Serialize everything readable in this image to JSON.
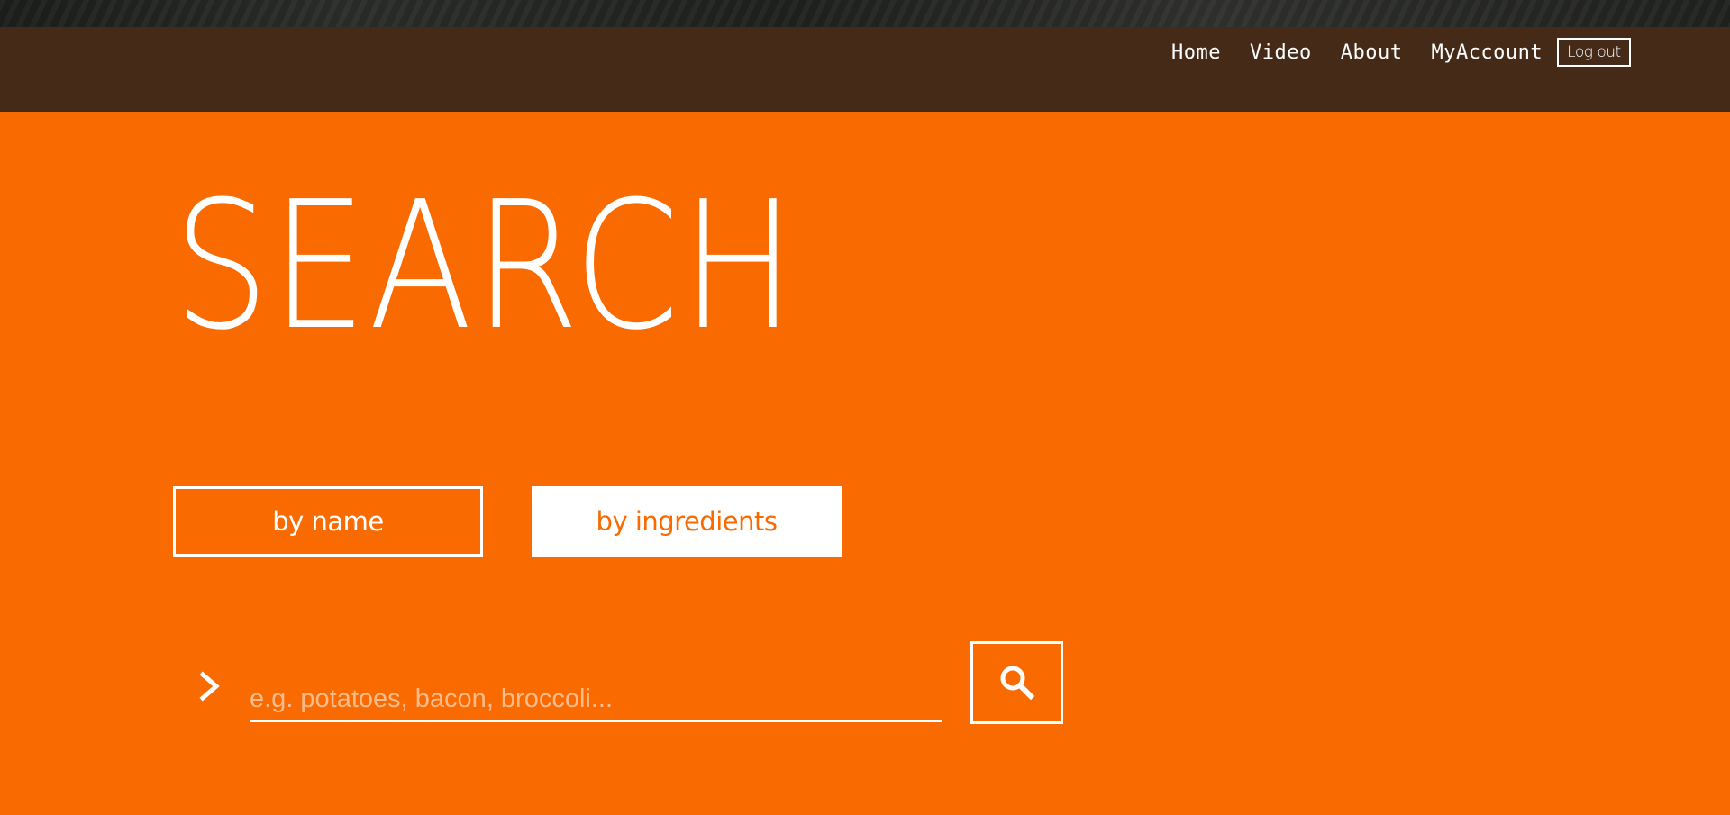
{
  "nav": {
    "links": [
      "Home",
      "Video",
      "About",
      "MyAccount"
    ],
    "logout_label": "Log out"
  },
  "main": {
    "title": "SEARCH",
    "modes": {
      "by_name_label": "by name",
      "by_ingredients_label": "by ingredients",
      "active": "by ingredients"
    },
    "search": {
      "value": "",
      "placeholder": "e.g. potatoes, bacon, broccoli...",
      "prompt_icon": "chevron-right-icon",
      "button_icon": "search-icon"
    }
  },
  "colors": {
    "accent": "#f96a00",
    "navbar": "#452a17",
    "text": "#ffffff"
  }
}
